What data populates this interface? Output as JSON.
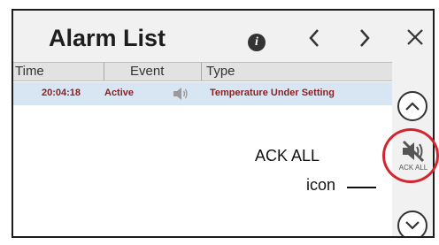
{
  "header": {
    "title": "Alarm List",
    "info_icon": "info-icon",
    "prev_icon": "chevron-left-icon",
    "next_icon": "chevron-right-icon",
    "close_icon": "close-icon",
    "info_glyph": "i",
    "prev_glyph": "‹",
    "next_glyph": "›",
    "close_glyph": "✕"
  },
  "table": {
    "columns": [
      "Time",
      "Event",
      "Type"
    ],
    "rows": [
      {
        "time": "20:04:18",
        "event": "Active",
        "sound_icon": "speaker-icon",
        "type": "Temperature Under Setting"
      }
    ]
  },
  "sidebar": {
    "scroll_up_icon": "chevron-up-icon",
    "ack_all_icon": "speaker-muted-icon",
    "ack_all_label": "ACK ALL",
    "scroll_down_icon": "chevron-down-icon"
  },
  "annotation": {
    "line1": "ACK ALL",
    "line2": "icon",
    "ring_color": "#d4252f"
  },
  "colors": {
    "row_highlight": "#d8e6f3",
    "alarm_text": "#8a1f1f"
  }
}
